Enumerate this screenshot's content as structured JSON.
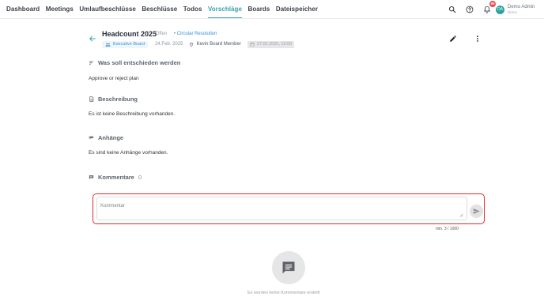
{
  "nav": {
    "items": [
      {
        "label": "Dashboard",
        "active": false
      },
      {
        "label": "Meetings",
        "active": false
      },
      {
        "label": "Umlaufbeschlüsse",
        "active": false
      },
      {
        "label": "Beschlüsse",
        "active": false
      },
      {
        "label": "Todos",
        "active": false
      },
      {
        "label": "Vorschläge",
        "active": true
      },
      {
        "label": "Boards",
        "active": false
      },
      {
        "label": "Dateispeicher",
        "active": false
      }
    ],
    "notification_count": "99",
    "avatar_initials": "DA",
    "user_name": "Demo Admin",
    "user_sub": "Demo",
    "accent_color": "#3aa0b5",
    "icons": [
      "search-icon",
      "help-icon",
      "bell-icon"
    ]
  },
  "proposal": {
    "title": "Headcount 2025",
    "status_open": "• Offen",
    "status_circular": "• Circular Resolution",
    "board_tag": "Executive Board",
    "date": "24.Feb. 2025",
    "member": "Kevin Board Member",
    "deadline": "27.02.2025, 15:00"
  },
  "sections": {
    "decide_title": "Was soll entschieden werden",
    "decide_text": "Approve or reject plan",
    "description_title": "Beschreibung",
    "description_text": "Es ist keine Beschreibung vorhanden.",
    "attachments_title": "Anhänge",
    "attachments_text": "Es sind keine Anhänge vorhanden.",
    "comments_title": "Kommentare",
    "comments_count": "0"
  },
  "comment": {
    "placeholder": "Kommentar",
    "counter": "min. 3 / 1000",
    "highlight_color": "#e02a2a"
  },
  "empty_state": {
    "text": "Es wurden keine Kommentare erstellt"
  }
}
